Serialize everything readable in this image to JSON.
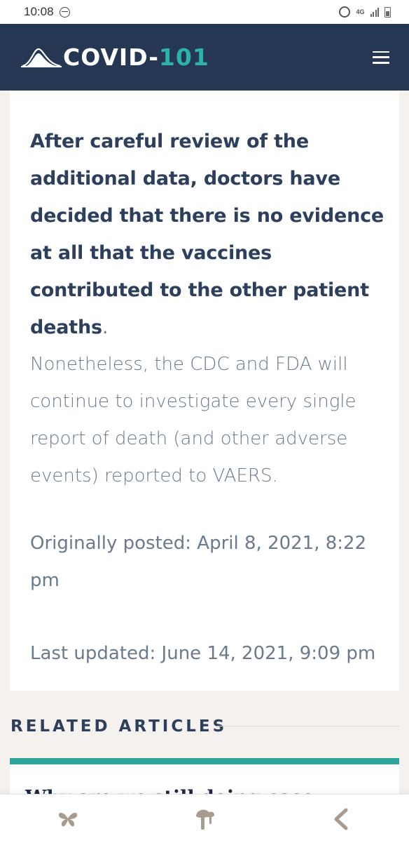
{
  "status_bar": {
    "time": "10:08",
    "network_label": "4G"
  },
  "header": {
    "logo_prefix": "COVID-",
    "logo_accent": "101",
    "colors": {
      "background": "#253753",
      "accent": "#2ab3a6"
    }
  },
  "article": {
    "lead_bold": "After careful review of the additional data, doctors have decided that there is no evidence at all that the vaccines contributed to the other patient deaths",
    "lead_end": ".",
    "body": "Nonetheless, the CDC and FDA will continue to investigate every single report of death (and other adverse events) reported to VAERS.",
    "posted": "Originally posted: April 8, 2021, 8:22 pm",
    "updated": "Last updated: June 14, 2021, 9:09 pm"
  },
  "related": {
    "heading": "RELATED ARTICLES",
    "items": [
      {
        "title": "Why are we still doing case"
      }
    ],
    "accent_color": "#2ea59a"
  },
  "bottom_nav": {
    "icons": [
      "butterfly-icon",
      "mushroom-icon",
      "back-icon"
    ]
  }
}
